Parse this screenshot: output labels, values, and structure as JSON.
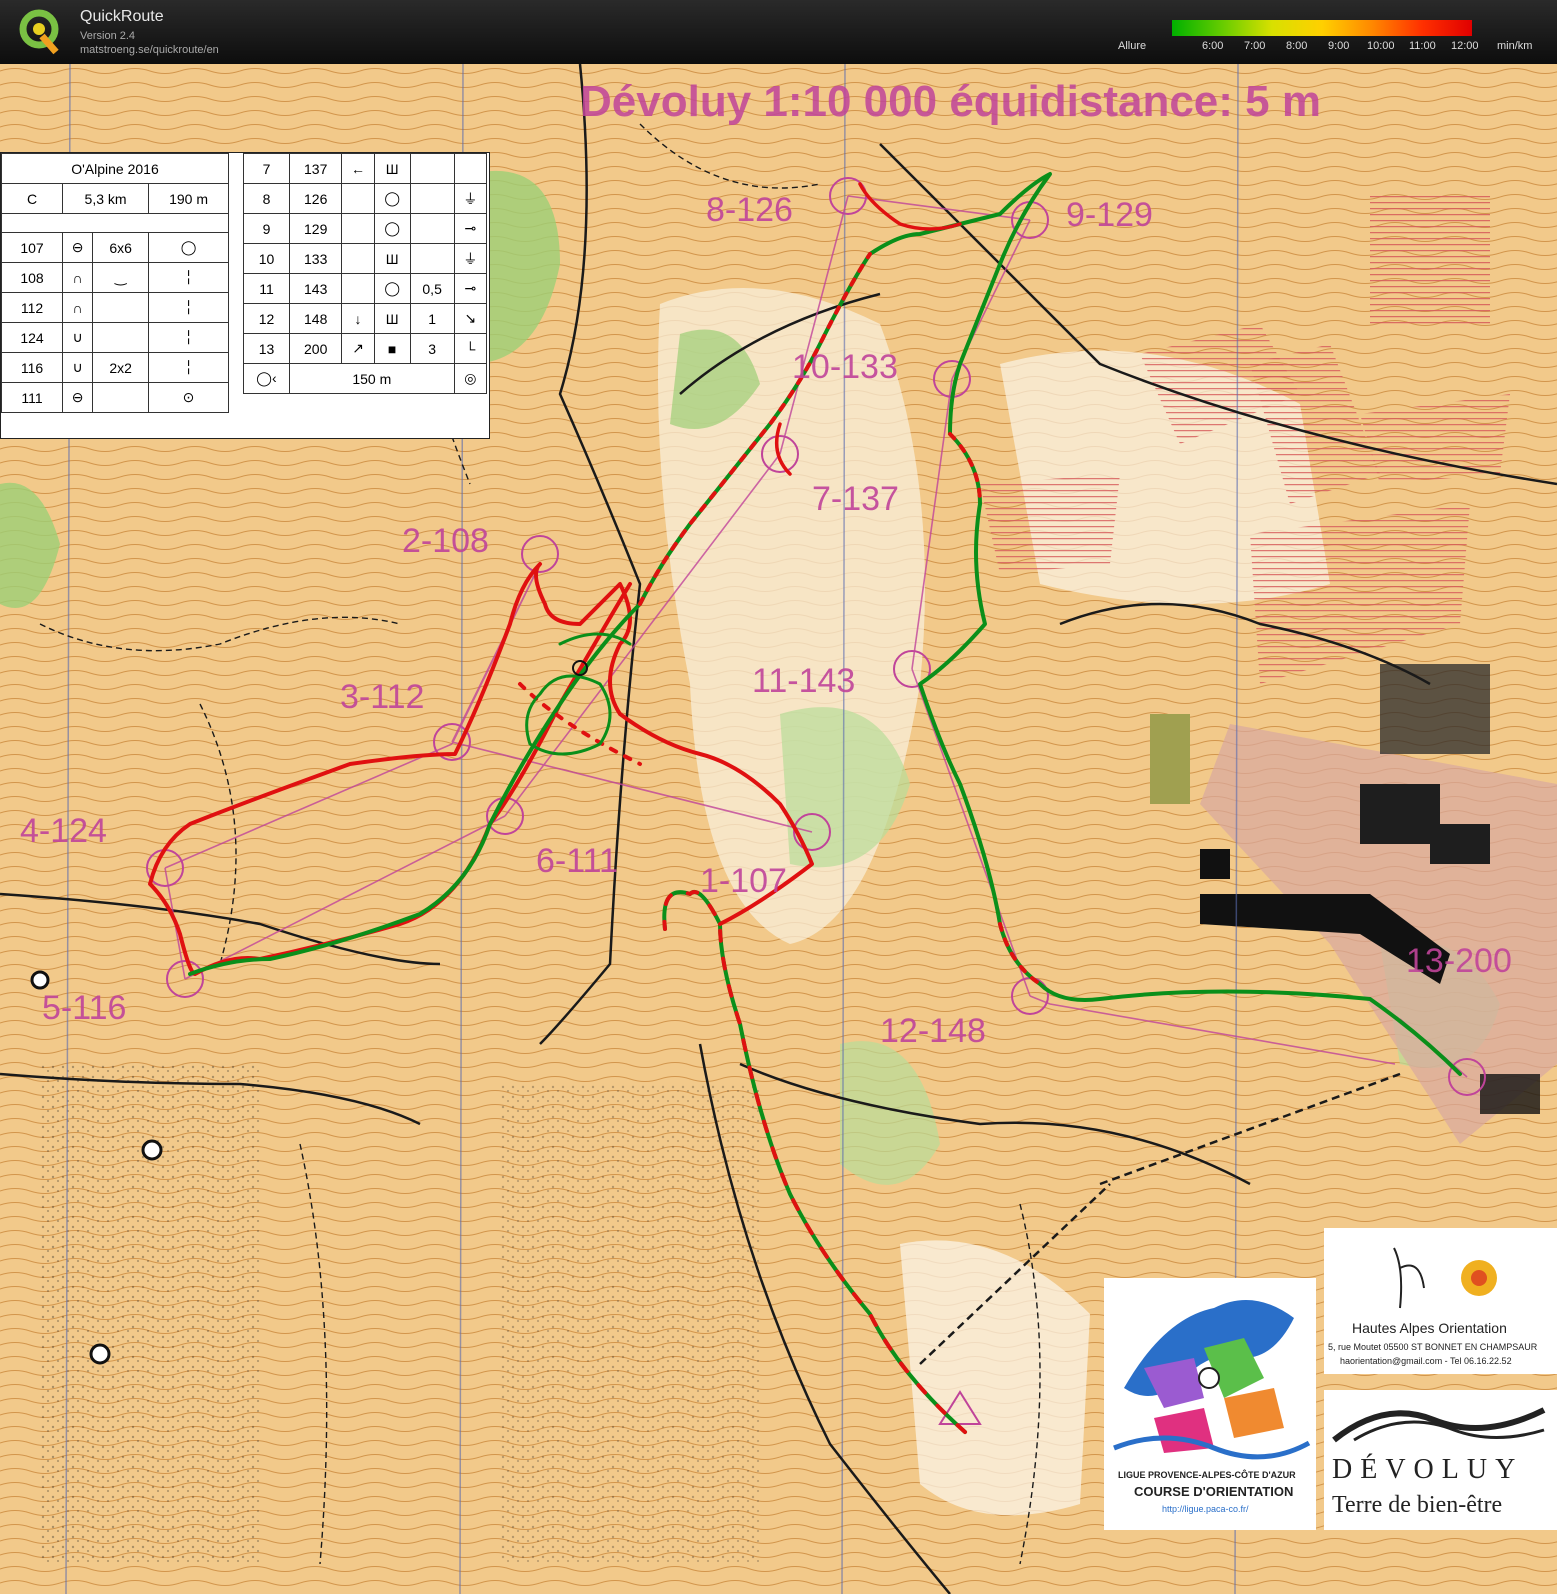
{
  "app": {
    "title": "QuickRoute",
    "version": "Version 2.4",
    "url": "matstroeng.se/quickroute/en"
  },
  "pace_legend": {
    "label": "Allure",
    "ticks": [
      "6:00",
      "7:00",
      "8:00",
      "9:00",
      "10:00",
      "11:00",
      "12:00"
    ],
    "unit": "min/km",
    "colors": [
      "#00b000",
      "#66cc00",
      "#d8e000",
      "#ffd000",
      "#ff8800",
      "#ff3000",
      "#e00000"
    ]
  },
  "map": {
    "title_line": "Dévoluy   1:10 000    équidistance: 5 m",
    "controls": [
      {
        "label": "8-126"
      },
      {
        "label": "9-129"
      },
      {
        "label": "10-133"
      },
      {
        "label": "7-137"
      },
      {
        "label": "2-108"
      },
      {
        "label": "11-143"
      },
      {
        "label": "3-112"
      },
      {
        "label": "4-124"
      },
      {
        "label": "6-111"
      },
      {
        "label": "1-107"
      },
      {
        "label": "13-200"
      },
      {
        "label": "5-116"
      },
      {
        "label": "12-148"
      }
    ],
    "colors": {
      "background": "#f2c98a",
      "contour": "#b86a18",
      "course": "#c0449a",
      "forest_green": "#9ccf76",
      "track_fast": "#0a8f1a",
      "track_slow": "#e01010",
      "paths": "#1a1a1a",
      "restricted": "#d65a5a"
    }
  },
  "control_description": {
    "event": "O'Alpine 2016",
    "course_class": "C",
    "distance": "5,3 km",
    "climb": "190 m",
    "left_rows": [
      {
        "code": "107",
        "feature": "⊖",
        "dim": "6x6",
        "where": "◯"
      },
      {
        "code": "108",
        "feature": "∩",
        "dim": "‿",
        "where": "╎"
      },
      {
        "code": "112",
        "feature": "∩",
        "dim": "",
        "where": "╎"
      },
      {
        "code": "124",
        "feature": "∪",
        "dim": "",
        "where": "╎"
      },
      {
        "code": "116",
        "feature": "∪",
        "dim": "2x2",
        "where": "╎"
      },
      {
        "code": "111",
        "feature": "⊖",
        "dim": "",
        "where": "⊙"
      }
    ],
    "right_rows": [
      {
        "num": "7",
        "code": "137",
        "dir": "←",
        "feature": "Ш",
        "dim": "",
        "where": ""
      },
      {
        "num": "8",
        "code": "126",
        "dir": "",
        "feature": "◯",
        "dim": "",
        "where": "⏚"
      },
      {
        "num": "9",
        "code": "129",
        "dir": "",
        "feature": "◯",
        "dim": "",
        "where": "⊸"
      },
      {
        "num": "10",
        "code": "133",
        "dir": "",
        "feature": "Ш",
        "dim": "",
        "where": "⏚"
      },
      {
        "num": "11",
        "code": "143",
        "dir": "",
        "feature": "◯",
        "dim": "0,5",
        "where": "⊸"
      },
      {
        "num": "12",
        "code": "148",
        "dir": "↓",
        "feature": "Ш",
        "dim": "1",
        "where": "↘"
      },
      {
        "num": "13",
        "code": "200",
        "dir": "↗",
        "feature": "■",
        "dim": "3",
        "where": "└"
      }
    ],
    "finish_distance": "150 m"
  },
  "sponsors": {
    "hao": {
      "name": "Hautes Alpes Orientation",
      "address": "5, rue Moutet  05500 ST BONNET EN CHAMPSAUR",
      "contact": "haorientation@gmail.com - Tel 06.16.22.52"
    },
    "ligue": {
      "line1": "LIGUE PROVENCE-ALPES-CÔTE D'AZUR",
      "line2": "COURSE D'ORIENTATION",
      "url": "http://ligue.paca-co.fr/"
    },
    "devoluy": {
      "name": "DÉVOLUY",
      "tagline": "Terre de bien-être"
    }
  }
}
